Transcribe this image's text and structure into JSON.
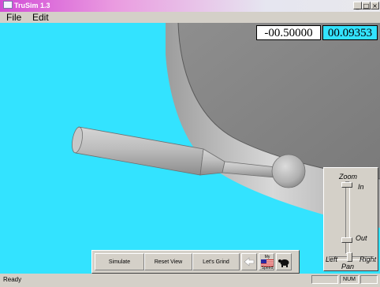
{
  "window": {
    "title": "TruSim 1.3",
    "min_label": "_",
    "max_label": "□",
    "close_label": "×"
  },
  "menu": {
    "file": "File",
    "edit": "Edit"
  },
  "readouts": {
    "position": "-00.50000",
    "value": "00.09353",
    "position_bg": "#ffffff",
    "value_bg": "#33e3ff"
  },
  "viewport": {
    "background": "#33e3ff"
  },
  "toolbar": {
    "simulate": "Simulate",
    "reset_view": "Reset View",
    "lets_grind": "Let's Grind",
    "speed_top": "My",
    "speed_bottom": "Speed",
    "back_icon": "back-arrow-icon",
    "flag_icon": "flag-icon",
    "turtle_icon": "turtle-icon"
  },
  "zoom_panel": {
    "zoom": "Zoom",
    "in": "In",
    "out": "Out",
    "left": "Left",
    "right": "Right",
    "pan": "Pan"
  },
  "status": {
    "text": "Ready",
    "num": "NUM"
  }
}
